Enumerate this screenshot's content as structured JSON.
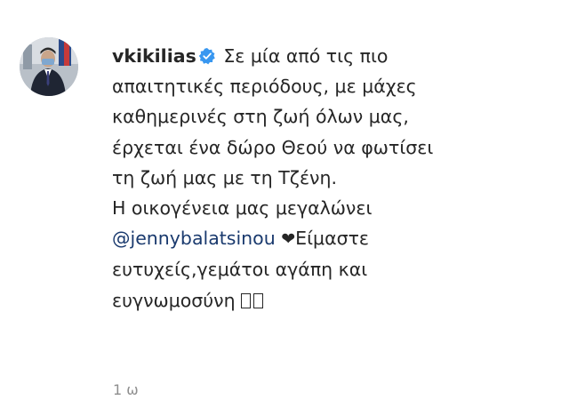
{
  "comment": {
    "username": "vkikilias",
    "verified": true,
    "lines": [
      "Σε μία από τις πιο",
      "απαιτητικές περιόδους, με μάχες",
      "καθημερινές στη ζωή όλων μας,",
      "έρχεται ένα δώρο Θεού να φωτίσει",
      "τη ζωή μας με τη Τζένη.",
      "Η οικογένεια μας μεγαλώνει"
    ],
    "mention": "@jennybalatsinou",
    "heart": "❤",
    "after_mention": "Είμαστε",
    "line_8": "ευτυχείς,γεμάτοι αγάπη και",
    "line_9": "ευγνωμοσύνη",
    "timestamp": "1 ω"
  },
  "icons": {
    "verified_badge": "verified-badge-icon",
    "heart": "heart-icon",
    "accent_color": "#3897f0",
    "mention_color": "#1a3a6e"
  }
}
